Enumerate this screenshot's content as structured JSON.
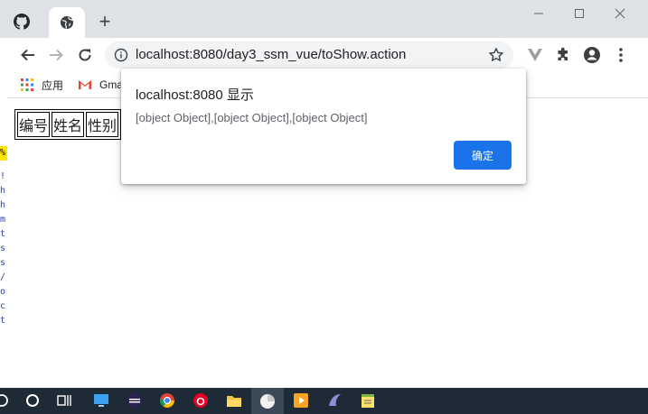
{
  "browser": {
    "address_bar": {
      "url": "localhost:8080/day3_ssm_vue/toShow.action"
    },
    "bookmarks": [
      {
        "label": "应用",
        "icon": "apps-grid-icon"
      },
      {
        "label": "Gma",
        "icon": "gmail-icon"
      }
    ]
  },
  "page": {
    "table": {
      "headers": [
        "编号",
        "姓名",
        "性别"
      ]
    }
  },
  "dialog": {
    "title": "localhost:8080 显示",
    "message": "[object Object],[object Object],[object Object]",
    "ok_label": "确定",
    "ok_color": "#1a73e8"
  },
  "left_strip": {
    "chars": [
      "%",
      "!",
      "h",
      "h",
      "m",
      "t",
      "s",
      "s",
      "/",
      "o",
      "c",
      "t"
    ]
  }
}
